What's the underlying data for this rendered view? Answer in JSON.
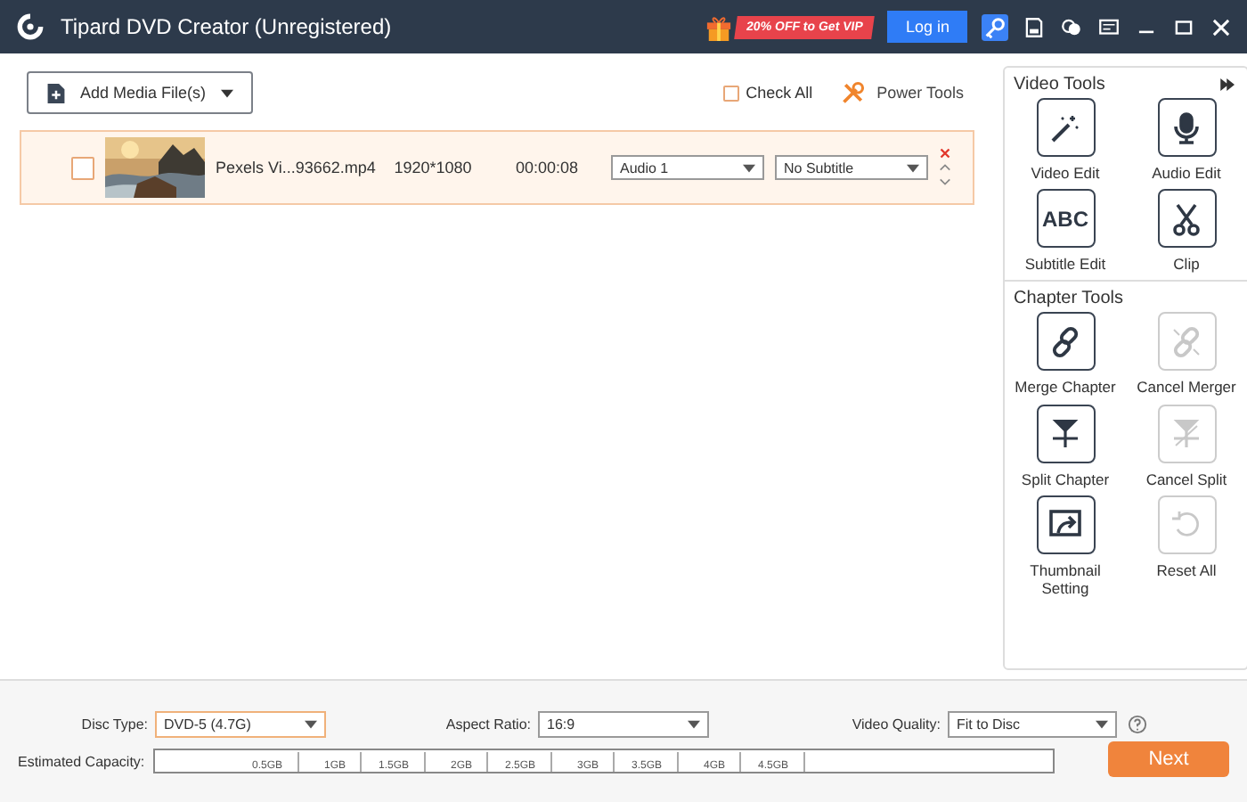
{
  "window": {
    "title": "Tipard DVD Creator (Unregistered)",
    "promo": "20% OFF to Get VIP",
    "login": "Log in"
  },
  "toolbar": {
    "add_media": "Add Media File(s)",
    "check_all": {
      "label": "Check All",
      "checked": false
    },
    "power_tools": "Power Tools"
  },
  "files": [
    {
      "name": "Pexels Vi...93662.mp4",
      "resolution": "1920*1080",
      "duration": "00:00:08",
      "audio": "Audio 1",
      "subtitle": "No Subtitle",
      "checked": false
    }
  ],
  "video_tools": {
    "title": "Video Tools",
    "items": [
      {
        "label": "Video Edit",
        "disabled": false
      },
      {
        "label": "Audio Edit",
        "disabled": false
      },
      {
        "label": "Subtitle Edit",
        "disabled": false,
        "icon_text": "ABC"
      },
      {
        "label": "Clip",
        "disabled": false
      }
    ]
  },
  "chapter_tools": {
    "title": "Chapter Tools",
    "items": [
      {
        "label": "Merge Chapter",
        "disabled": false
      },
      {
        "label": "Cancel Merger",
        "disabled": true
      },
      {
        "label": "Split Chapter",
        "disabled": false
      },
      {
        "label": "Cancel Split",
        "disabled": true
      },
      {
        "label": "Thumbnail Setting",
        "disabled": false
      },
      {
        "label": "Reset All",
        "disabled": true
      }
    ]
  },
  "settings": {
    "disc_type": {
      "label": "Disc Type:",
      "value": "DVD-5 (4.7G)"
    },
    "aspect_ratio": {
      "label": "Aspect Ratio:",
      "value": "16:9"
    },
    "video_quality": {
      "label": "Video Quality:",
      "value": "Fit to Disc"
    }
  },
  "capacity": {
    "label": "Estimated Capacity:",
    "ticks": [
      "0.5GB",
      "1GB",
      "1.5GB",
      "2GB",
      "2.5GB",
      "3GB",
      "3.5GB",
      "4GB",
      "4.5GB"
    ]
  },
  "next": "Next"
}
